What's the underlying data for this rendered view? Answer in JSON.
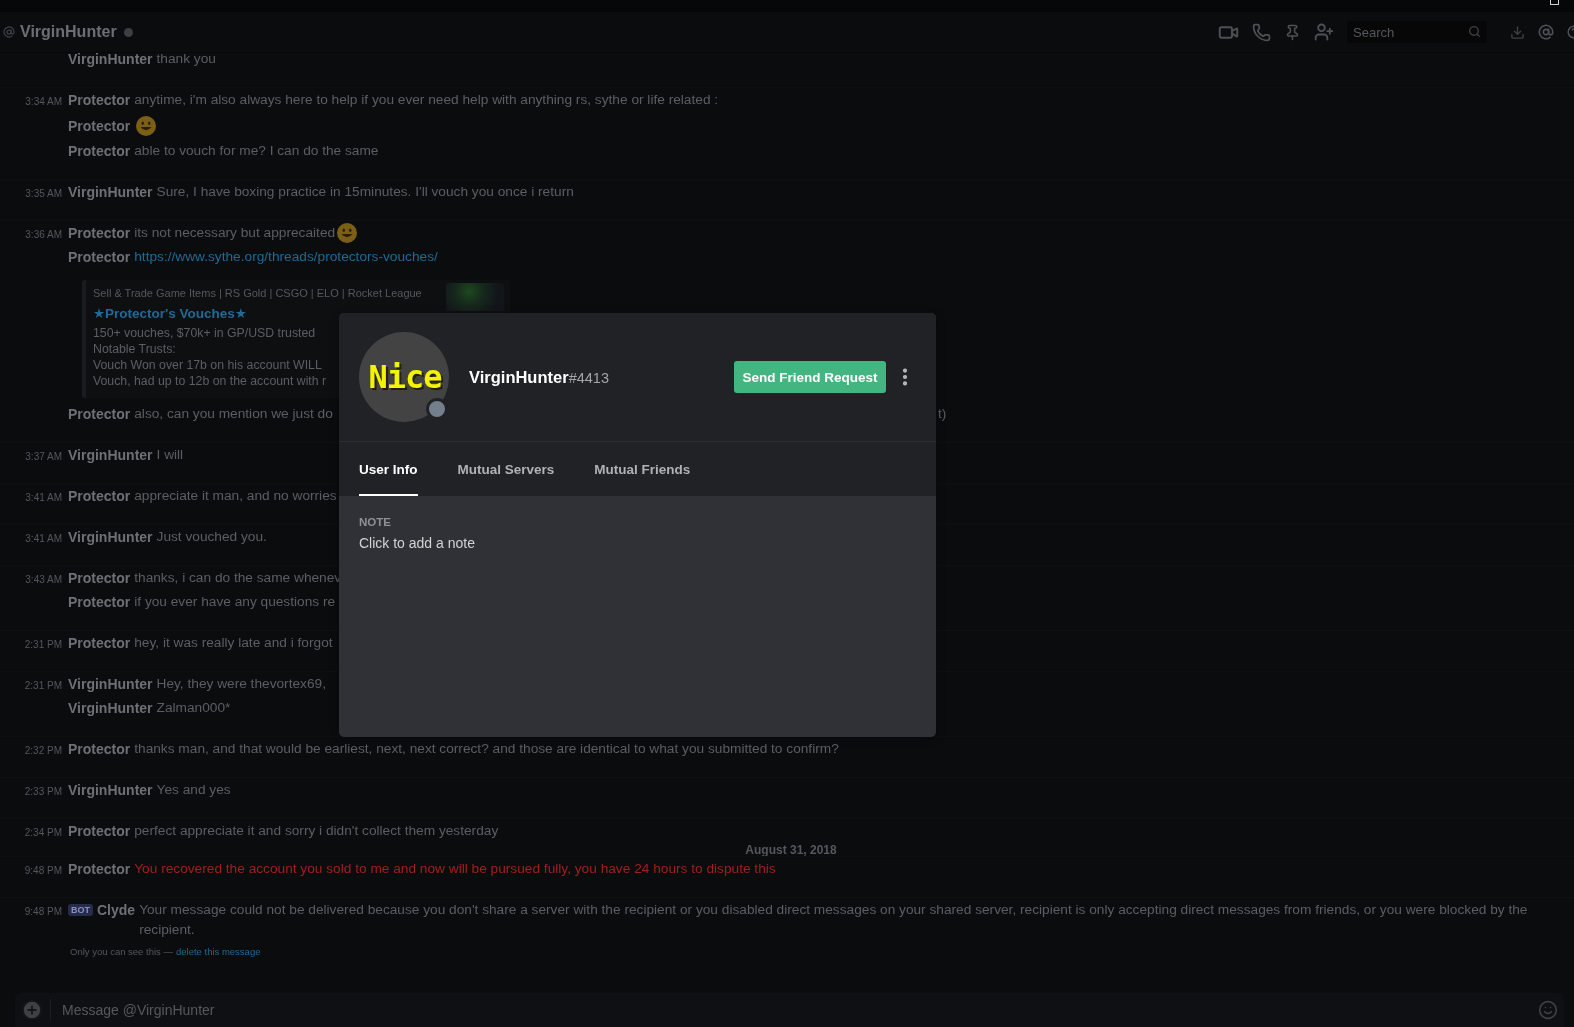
{
  "header": {
    "channel_name": "VirginHunter",
    "online": false,
    "search": {
      "placeholder": "Search"
    }
  },
  "groups": [
    {
      "kind": "messages",
      "lines": [
        {
          "kind": "text",
          "author": "VirginHunter",
          "text": "thank you"
        }
      ]
    },
    {
      "kind": "messages",
      "time": "3:34 AM",
      "lines": [
        {
          "kind": "text",
          "author": "Protector",
          "text": "anytime, i'm also always here to help if you ever need help with anything rs, sythe or life related :"
        },
        {
          "kind": "text",
          "author": "Protector",
          "emoji": true
        },
        {
          "kind": "text",
          "author": "Protector",
          "text": "able to vouch for me? I can do the same"
        }
      ]
    },
    {
      "kind": "messages",
      "time": "3:35 AM",
      "lines": [
        {
          "kind": "text",
          "author": "VirginHunter",
          "text": "Sure, I have boxing practice in 15minutes. I'll vouch you once i return"
        }
      ]
    },
    {
      "kind": "messages",
      "time": "3:36 AM",
      "lines": [
        {
          "kind": "text",
          "author": "Protector",
          "text": "its not necessary but apprecaited",
          "emoji": true
        },
        {
          "kind": "link",
          "author": "Protector",
          "url": "https://www.sythe.org/threads/protectors-vouches/"
        },
        {
          "kind": "embed",
          "provider": "Sell & Trade Game Items | RS Gold | CSGO | ELO | Rocket League",
          "title": "★Protector's Vouches★",
          "description": "150+ vouches, $70k+ in GP/USD trusted\nNotable Trusts:\nVouch Won over 17b on his account WILL\nVouch, had up to 12b on the account with r"
        },
        {
          "kind": "text",
          "author": "Protector",
          "text": "also, can you mention we just do",
          "tail": "t)"
        }
      ]
    },
    {
      "kind": "messages",
      "time": "3:37 AM",
      "lines": [
        {
          "kind": "text",
          "author": "VirginHunter",
          "text": "I will"
        }
      ]
    },
    {
      "kind": "messages",
      "time": "3:41 AM",
      "lines": [
        {
          "kind": "text",
          "author": "Protector",
          "text": "appreciate it man, and no worries"
        }
      ]
    },
    {
      "kind": "messages",
      "time": "3:41 AM",
      "lines": [
        {
          "kind": "text",
          "author": "VirginHunter",
          "text": "Just vouched you."
        }
      ]
    },
    {
      "kind": "messages",
      "time": "3:43 AM",
      "lines": [
        {
          "kind": "text",
          "author": "Protector",
          "text": "thanks, i can do the same whenev"
        },
        {
          "kind": "text",
          "author": "Protector",
          "text": "if you ever have any questions re"
        }
      ]
    },
    {
      "kind": "messages",
      "time": "2:31 PM",
      "lines": [
        {
          "kind": "text",
          "author": "Protector",
          "text": "hey, it was really late and i forgot"
        }
      ]
    },
    {
      "kind": "messages",
      "time": "2:31 PM",
      "lines": [
        {
          "kind": "text",
          "author": "VirginHunter",
          "text": "Hey, they were thevortex69,"
        },
        {
          "kind": "text",
          "author": "VirginHunter",
          "text": "Zalman000*"
        }
      ]
    },
    {
      "kind": "messages",
      "time": "2:32 PM",
      "lines": [
        {
          "kind": "text",
          "author": "Protector",
          "text": "thanks man, and that would be earliest, next, next correct? and those are identical to what you submitted to confirm?"
        }
      ]
    },
    {
      "kind": "messages",
      "time": "2:33 PM",
      "lines": [
        {
          "kind": "text",
          "author": "VirginHunter",
          "text": "Yes and yes"
        }
      ]
    },
    {
      "kind": "messages",
      "time": "2:34 PM",
      "lines": [
        {
          "kind": "text",
          "author": "Protector",
          "text": "perfect appreciate it and sorry i didn't collect them yesterday"
        }
      ]
    },
    {
      "kind": "divider",
      "text": "August 31, 2018"
    },
    {
      "kind": "messages",
      "time": "9:48 PM",
      "lines": [
        {
          "kind": "text",
          "author": "Protector",
          "text": "You recovered the account you sold to me and now will be pursued fully, you have 24 hours to dispute this",
          "color": "#a31e1e"
        }
      ]
    },
    {
      "kind": "messages",
      "time": "9:48 PM",
      "lines": [
        {
          "kind": "bot",
          "badge": "BOT",
          "author": "Clyde",
          "text": "Your message could not be delivered because you don't share a server with the recipient or you disabled direct messages on your shared server, recipient is only accepting direct messages from friends, or you were blocked by the recipient.",
          "note": "Only you can see this —",
          "note_link": "delete this message"
        }
      ]
    }
  ],
  "modal": {
    "avatar_text": "Nice",
    "online": false,
    "username": "VirginHunter",
    "discriminator": "#4413",
    "button": "Send Friend Request",
    "tabs": [
      {
        "label": "User Info",
        "selected": true
      },
      {
        "label": "Mutual Servers",
        "selected": false
      },
      {
        "label": "Mutual Friends",
        "selected": false
      }
    ],
    "note": {
      "label": "NOTE",
      "placeholder": "Click to add a note"
    }
  },
  "composer": {
    "placeholder": "Message @VirginHunter"
  }
}
